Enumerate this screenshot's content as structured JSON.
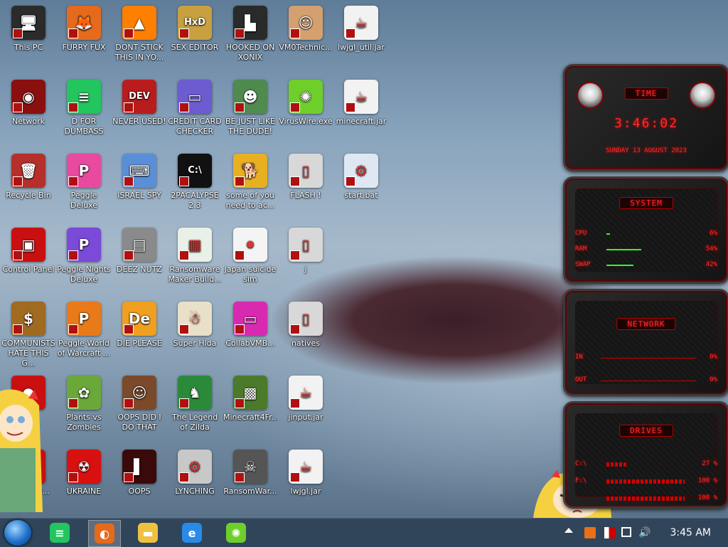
{
  "desktop": {
    "icons": [
      {
        "label": "This PC",
        "color": "#2b2b2b",
        "glyph": "🖥"
      },
      {
        "label": "FURRY FUX",
        "color": "#e66a1c",
        "glyph": "🦊"
      },
      {
        "label": "DONT STICK THIS IN YO...",
        "color": "#ff7f00",
        "glyph": "▲"
      },
      {
        "label": "SEX EDITOR",
        "color": "#c8a040",
        "glyph": "HxD"
      },
      {
        "label": "HOOKED ON XONIX",
        "color": "#2a2a2a",
        "glyph": "▙"
      },
      {
        "label": "VM0Technic...",
        "color": "#d4a070",
        "glyph": "☺"
      },
      {
        "label": "lwjgl_util.jar",
        "color": "#f2f2f2",
        "glyph": "☕"
      },
      {
        "label": "Network",
        "color": "#8a1010",
        "glyph": "◉"
      },
      {
        "label": "D FOR DUMBASS",
        "color": "#22c55e",
        "glyph": "≡"
      },
      {
        "label": "NEVER USED!",
        "color": "#b91c1c",
        "glyph": "DEV"
      },
      {
        "label": "CREDIT CARD CHECKER",
        "color": "#6d5bd0",
        "glyph": "▭"
      },
      {
        "label": "BE JUST LIKE THE DUDE!",
        "color": "#4f8a4f",
        "glyph": "☻"
      },
      {
        "label": "VirusWire.exe",
        "color": "#6fcf2a",
        "glyph": "✺"
      },
      {
        "label": "minecraft.jar",
        "color": "#f2f2f2",
        "glyph": "☕"
      },
      {
        "label": "Recycle Bin",
        "color": "#b5302a",
        "glyph": "🗑"
      },
      {
        "label": "Peggle Deluxe",
        "color": "#e84aa0",
        "glyph": "P"
      },
      {
        "label": "ISRAEL SPY",
        "color": "#5a8fd8",
        "glyph": "⌨"
      },
      {
        "label": "2PACALYPSE 2.3",
        "color": "#111111",
        "glyph": "C:\\"
      },
      {
        "label": "some of you need to ac...",
        "color": "#e8b020",
        "glyph": "🐕"
      },
      {
        "label": "FLASH !",
        "color": "#d8d8d8",
        "glyph": "▯"
      },
      {
        "label": "start.bat",
        "color": "#dfe8f2",
        "glyph": "⚙"
      },
      {
        "label": "Control Panel",
        "color": "#c81010",
        "glyph": "▣"
      },
      {
        "label": "Peggle Nights Deluxe",
        "color": "#7b4ad8",
        "glyph": "P"
      },
      {
        "label": "DEEZ NUTZ",
        "color": "#8a8a8a",
        "glyph": "▤"
      },
      {
        "label": "Ransomware Maker Build...",
        "color": "#e8f0e8",
        "glyph": "▦"
      },
      {
        "label": "japan suicide sim",
        "color": "#f4f4f4",
        "glyph": "⚫"
      },
      {
        "label": "j",
        "color": "#d8d8d8",
        "glyph": "▯"
      },
      {
        "label": "",
        "color": "",
        "glyph": ""
      },
      {
        "label": "COMMUNISTS HATE THIS G...",
        "color": "#a06a20",
        "glyph": "$"
      },
      {
        "label": "Peggle World of Warcraft ...",
        "color": "#e87a1a",
        "glyph": "P"
      },
      {
        "label": "DIE PLEASE",
        "color": "#f0a020",
        "glyph": "De"
      },
      {
        "label": "Super Hlda",
        "color": "#e8e0c8",
        "glyph": "☃"
      },
      {
        "label": "CollabVMB...",
        "color": "#d82ab0",
        "glyph": "▭"
      },
      {
        "label": "natives",
        "color": "#d8d8d8",
        "glyph": "▯"
      },
      {
        "label": "",
        "color": "",
        "glyph": ""
      },
      {
        "label": "...N",
        "color": "#c81010",
        "glyph": "●"
      },
      {
        "label": "Plants vs Zombies",
        "color": "#6aa83a",
        "glyph": "✿"
      },
      {
        "label": "OOPS DID I DO THAT",
        "color": "#7a4a2a",
        "glyph": "☺"
      },
      {
        "label": "The Legend of Zilda",
        "color": "#2a8a3a",
        "glyph": "♞"
      },
      {
        "label": "Minecraft4Fr...",
        "color": "#4a7a2a",
        "glyph": "▩"
      },
      {
        "label": "jinput.jar",
        "color": "#f2f2f2",
        "glyph": "☕"
      },
      {
        "label": "",
        "color": "",
        "glyph": ""
      },
      {
        "label": "...ad ...AI...",
        "color": "#c81010",
        "glyph": "●"
      },
      {
        "label": "UKRAINE",
        "color": "#d81010",
        "glyph": "☢"
      },
      {
        "label": "OOPS",
        "color": "#3a0a0a",
        "glyph": "▌"
      },
      {
        "label": "LYNCHING",
        "color": "#c8c8c8",
        "glyph": "⚙"
      },
      {
        "label": "RansomWar...",
        "color": "#555555",
        "glyph": "☠"
      },
      {
        "label": "lwjgl.jar",
        "color": "#f2f2f2",
        "glyph": "☕"
      },
      {
        "label": "",
        "color": "",
        "glyph": ""
      }
    ]
  },
  "widget": {
    "time": {
      "title": "TIME",
      "clock": "3:46:02",
      "date": "SUNDAY 13 AUGUST 2023"
    },
    "system": {
      "title": "SYSTEM",
      "rows": [
        {
          "name": "CPU",
          "value": "6%",
          "fill": 0.06
        },
        {
          "name": "RAM",
          "value": "54%",
          "fill": 0.54
        },
        {
          "name": "SWAP",
          "value": "42%",
          "fill": 0.42
        }
      ]
    },
    "network": {
      "title": "NETWORK",
      "rows": [
        {
          "name": "IN",
          "value": "0%"
        },
        {
          "name": "OUT",
          "value": "0%"
        }
      ]
    },
    "drives": {
      "title": "DRIVES",
      "rows": [
        {
          "name": "C:\\",
          "value": "27 %",
          "fill": 0.27
        },
        {
          "name": "F:\\",
          "value": "100 %",
          "fill": 1.0
        },
        {
          "name": "",
          "value": "100 %",
          "fill": 1.0
        }
      ]
    }
  },
  "taskbar": {
    "items": [
      {
        "name": "green-chat-app",
        "color": "#22c55e",
        "glyph": "≡"
      },
      {
        "name": "firefox-app",
        "color": "#e66a1c",
        "glyph": "◐"
      },
      {
        "name": "file-explorer-app",
        "color": "#f0c040",
        "glyph": "▬"
      },
      {
        "name": "internet-explorer-app",
        "color": "#2a8ae8",
        "glyph": "e"
      },
      {
        "name": "viruswire-app",
        "color": "#6fcf2a",
        "glyph": "✺"
      }
    ],
    "clock": "3:45 AM"
  },
  "colors": {
    "accent_red": "#ff2a2a",
    "bar_green": "#2cff2c"
  }
}
